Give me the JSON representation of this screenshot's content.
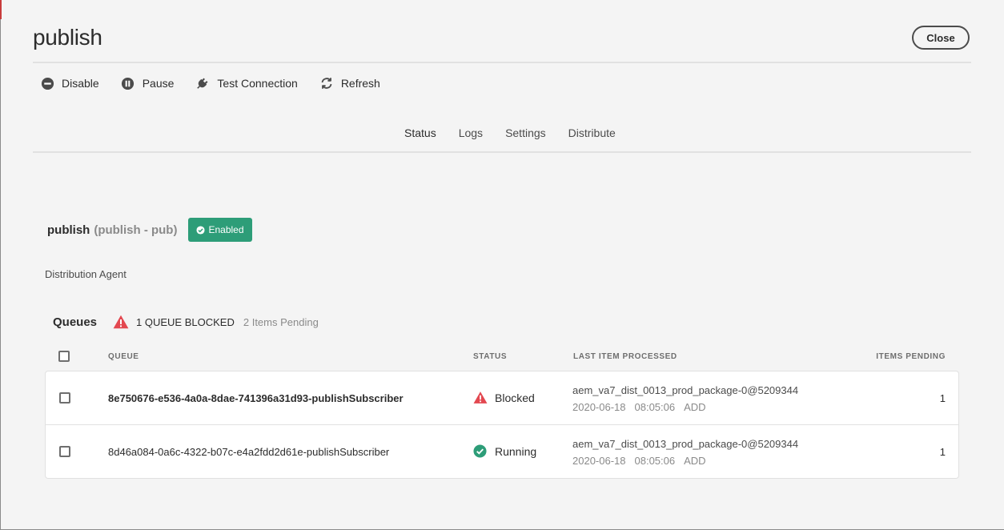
{
  "header": {
    "title": "publish",
    "close_label": "Close"
  },
  "actions": [
    {
      "label": "Disable",
      "icon": "minus-circle-icon"
    },
    {
      "label": "Pause",
      "icon": "pause-circle-icon"
    },
    {
      "label": "Test Connection",
      "icon": "plug-icon"
    },
    {
      "label": "Refresh",
      "icon": "refresh-icon"
    }
  ],
  "tabs": [
    {
      "label": "Status",
      "active": true
    },
    {
      "label": "Logs",
      "active": false
    },
    {
      "label": "Settings",
      "active": false
    },
    {
      "label": "Distribute",
      "active": false
    }
  ],
  "agent": {
    "name": "publish",
    "subtitle": "(publish - pub)",
    "status_badge": "Enabled",
    "description": "Distribution Agent"
  },
  "queues": {
    "title": "Queues",
    "blocked_text": "1 QUEUE BLOCKED",
    "pending_text": "2 Items Pending",
    "columns": {
      "queue": "QUEUE",
      "status": "STATUS",
      "last_item": "LAST ITEM PROCESSED",
      "items_pending": "ITEMS PENDING"
    },
    "rows": [
      {
        "queue": "8e750676-e536-4a0a-8dae-741396a31d93-publishSubscriber",
        "status": "Blocked",
        "last_item": "aem_va7_dist_0013_prod_package-0@5209344",
        "date": "2020-06-18",
        "time": "08:05:06",
        "action": "ADD",
        "pending": "1"
      },
      {
        "queue": "8d46a084-0a6c-4322-b07c-e4a2fdd2d61e-publishSubscriber",
        "status": "Running",
        "last_item": "aem_va7_dist_0013_prod_package-0@5209344",
        "date": "2020-06-18",
        "time": "08:05:06",
        "action": "ADD",
        "pending": "1"
      }
    ]
  },
  "colors": {
    "enabled": "#2d9d78",
    "blocked": "#e34850",
    "running": "#2d9d78"
  }
}
